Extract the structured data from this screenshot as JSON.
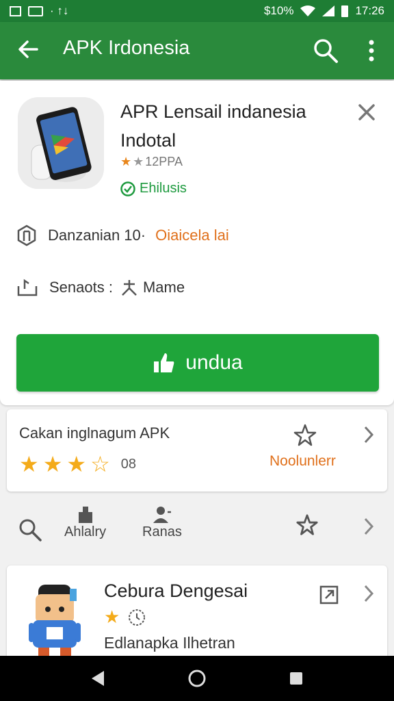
{
  "status_bar": {
    "left_text": "· ↑↓",
    "battery": "$10%",
    "time": "17:26"
  },
  "app_bar": {
    "title": "APK Irdonesia"
  },
  "app": {
    "name_line1": "APR Lensail indanesia",
    "name_line2": "Indotal",
    "rating_text": "12PPA",
    "verified_label": "Ehilusis"
  },
  "info": {
    "row1_label": "Danzanian 10·",
    "row1_link": "Oiaicela lai",
    "row2_label": "Senaots :",
    "row2_value": "Mame"
  },
  "download": {
    "label": "undua"
  },
  "rating_card": {
    "title": "Cakan inglnagum APK",
    "stars_full": 3,
    "stars_outline": 1,
    "count": "08",
    "rate_label": "Noolunlerr"
  },
  "tools": [
    {
      "label": "Ahlalry"
    },
    {
      "label": "Ranas"
    }
  ],
  "featured": {
    "name": "Cebura Dengesai",
    "description": "Edlanapka Ilhetran"
  },
  "colors": {
    "primary": "#2a8a3c",
    "status": "#1e7d34",
    "accent_green": "#1fa53a",
    "orange": "#e0701b",
    "star": "#f4ab1a"
  }
}
